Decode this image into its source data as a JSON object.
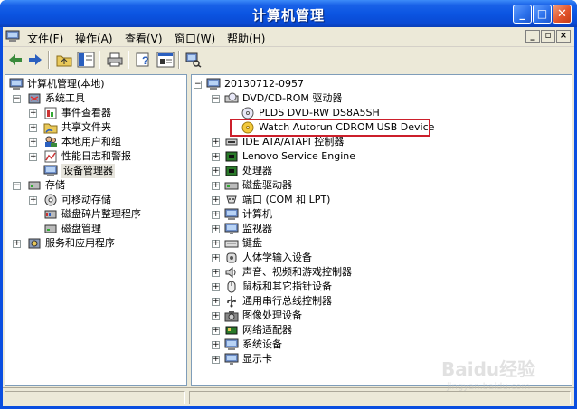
{
  "window": {
    "title": "计算机管理"
  },
  "menu": {
    "items": [
      "文件(F)",
      "操作(A)",
      "查看(V)",
      "窗口(W)",
      "帮助(H)"
    ]
  },
  "left_tree": {
    "root": "计算机管理(本地)",
    "system_tools": "系统工具",
    "system_children": [
      "事件查看器",
      "共享文件夹",
      "本地用户和组",
      "性能日志和警报",
      "设备管理器"
    ],
    "storage": "存储",
    "storage_children": [
      "可移动存储",
      "磁盘碎片整理程序",
      "磁盘管理"
    ],
    "services": "服务和应用程序"
  },
  "right_tree": {
    "computer": "20130712-0957",
    "dvd_category": "DVD/CD-ROM 驱动器",
    "dvd_children": [
      "PLDS DVD-RW DS8A5SH",
      "Watch Autorun CDROM USB Device"
    ],
    "categories": [
      "IDE ATA/ATAPI 控制器",
      "Lenovo Service Engine",
      "处理器",
      "磁盘驱动器",
      "端口 (COM 和 LPT)",
      "计算机",
      "监视器",
      "键盘",
      "人体学输入设备",
      "声音、视频和游戏控制器",
      "鼠标和其它指针设备",
      "通用串行总线控制器",
      "图像处理设备",
      "网络适配器",
      "系统设备",
      "显示卡"
    ]
  },
  "watermark": {
    "brand": "Baidu经验",
    "url": "jingyan.baidu.com"
  },
  "colors": {
    "titlebar": "#0b55e2",
    "highlight_box": "#cc1f2b",
    "client_bg": "#ece9d8"
  }
}
